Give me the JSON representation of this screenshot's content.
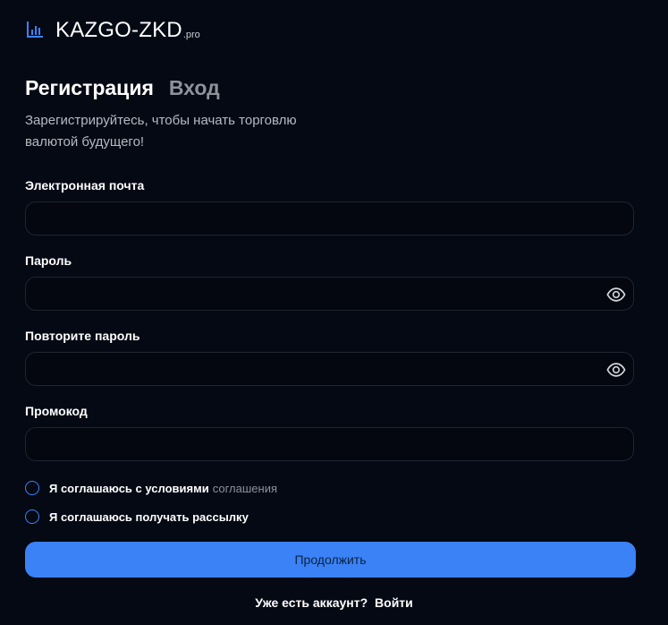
{
  "brand": {
    "name": "KAZGO-ZKD",
    "suffix": ".pro",
    "icon": "bar-chart-icon",
    "accent": "#3b82f6"
  },
  "tabs": {
    "active": "Регистрация",
    "inactive": "Вход"
  },
  "subtitle": "Зарегистрируйтесь, чтобы начать торговлю валютой будущего!",
  "fields": {
    "email": {
      "label": "Электронная почта",
      "value": "",
      "placeholder": ""
    },
    "password": {
      "label": "Пароль",
      "value": "",
      "placeholder": "",
      "icon": "eye-icon"
    },
    "repeat_password": {
      "label": "Повторите пароль",
      "value": "",
      "placeholder": "",
      "icon": "eye-icon"
    },
    "promo": {
      "label": "Промокод",
      "value": "",
      "placeholder": ""
    }
  },
  "checks": {
    "terms": {
      "text": "Я соглашаюсь с условиями",
      "link": "соглашения"
    },
    "newsletter": {
      "text": "Я соглашаюсь получать рассылку"
    }
  },
  "submit_label": "Продолжить",
  "footer": {
    "question": "Уже есть аккаунт?",
    "link": "Войти"
  }
}
